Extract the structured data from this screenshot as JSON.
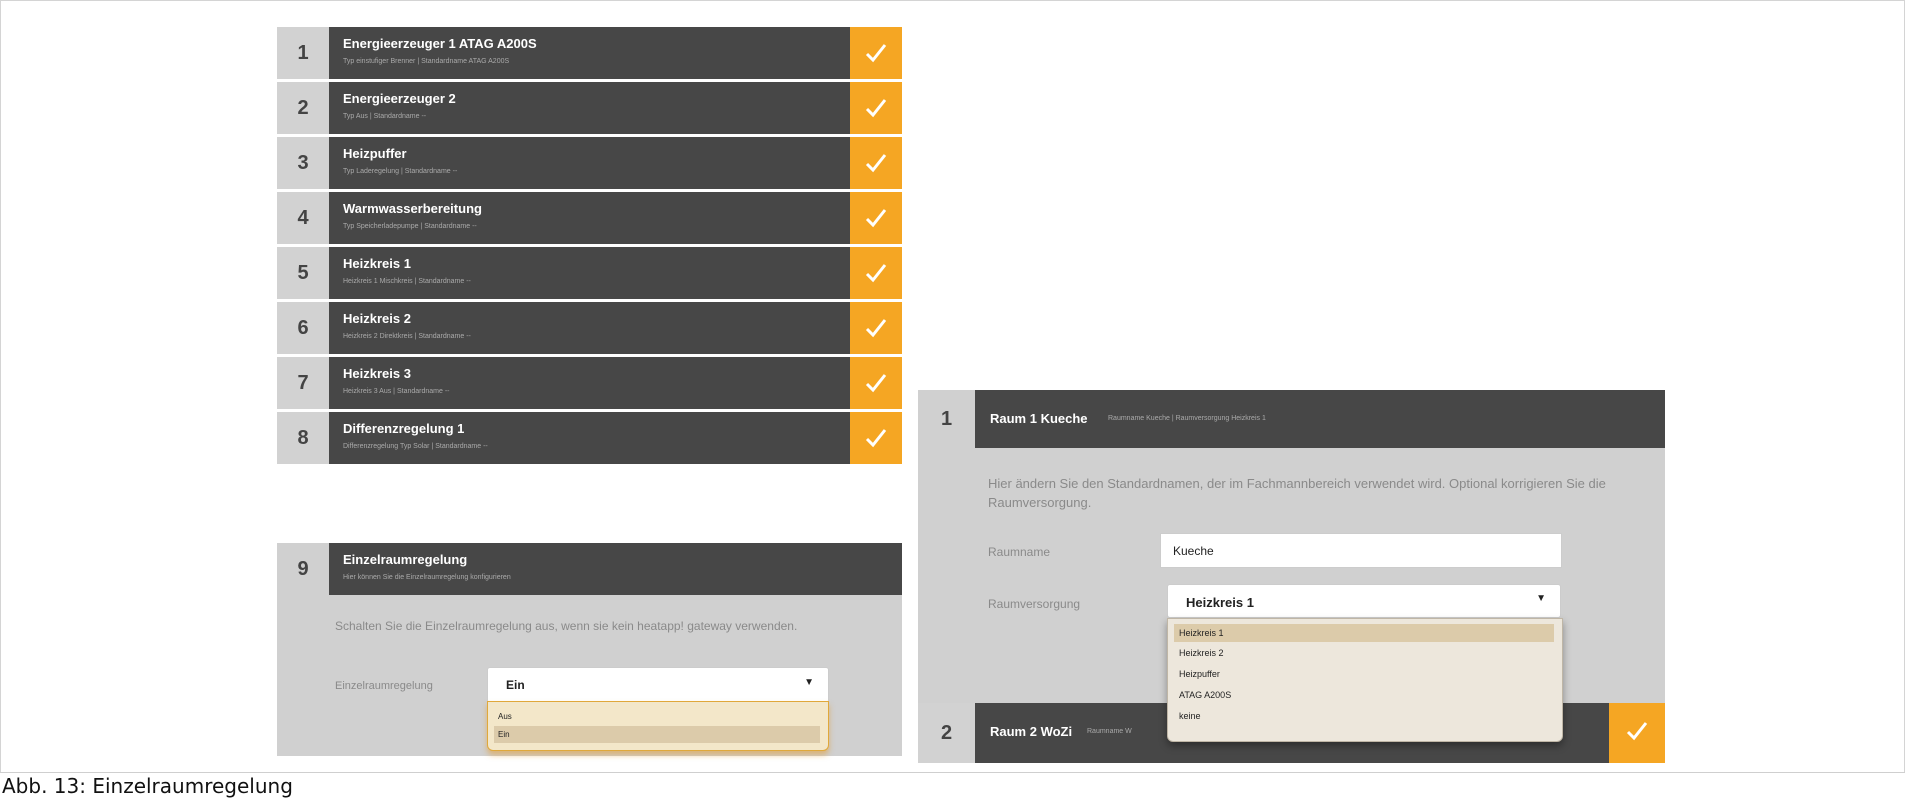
{
  "left": {
    "steps": [
      {
        "num": "1",
        "title": "Energieerzeuger 1 ATAG A200S",
        "sub": "Typ einstufiger Brenner | Standardname ATAG A200S"
      },
      {
        "num": "2",
        "title": "Energieerzeuger 2",
        "sub": "Typ Aus | Standardname --"
      },
      {
        "num": "3",
        "title": "Heizpuffer",
        "sub": "Typ Laderegelung | Standardname --"
      },
      {
        "num": "4",
        "title": "Warmwasserbereitung",
        "sub": "Typ Speicherladepumpe | Standardname --"
      },
      {
        "num": "5",
        "title": "Heizkreis 1",
        "sub": "Heizkreis 1 Mischkreis | Standardname --"
      },
      {
        "num": "6",
        "title": "Heizkreis 2",
        "sub": "Heizkreis 2 Direktkreis | Standardname --"
      },
      {
        "num": "7",
        "title": "Heizkreis 3",
        "sub": "Heizkreis 3 Aus | Standardname --"
      },
      {
        "num": "8",
        "title": "Differenzregelung 1",
        "sub": "Differenzregelung Typ Solar | Standardname --"
      }
    ],
    "step9": {
      "num": "9",
      "title": "Einzelraumregelung",
      "sub": "Hier können Sie die Einzelraumregelung konfigurieren",
      "hint": "Schalten Sie die Einzelraumregelung aus, wenn sie kein heatapp! gateway verwenden.",
      "label": "Einzelraumregelung",
      "value": "Ein",
      "options": [
        "Aus",
        "Ein"
      ]
    }
  },
  "right": {
    "row1": {
      "num": "1",
      "title": "Raum 1 Kueche",
      "sub": "Raumname Kueche | Raumversorgung Heizkreis 1",
      "hint": "Hier ändern Sie den Standardnamen, der im Fachmannbereich verwendet wird. Optional korrigieren Sie die Raumversorgung.",
      "label_name": "Raumname",
      "name_value": "Kueche",
      "label_supply": "Raumversorgung",
      "supply_value": "Heizkreis 1",
      "options": [
        "Heizkreis 1",
        "Heizkreis 2",
        "Heizpuffer",
        "ATAG A200S",
        "keine"
      ]
    },
    "row2": {
      "num": "2",
      "title": "Raum 2 WoZi",
      "sub": "Raumname W"
    }
  },
  "caption": "Abb. 13: Einzelraumregelung",
  "colors": {
    "accent": "#f5a623",
    "bar": "#474747",
    "panel": "#d0d0d0"
  }
}
